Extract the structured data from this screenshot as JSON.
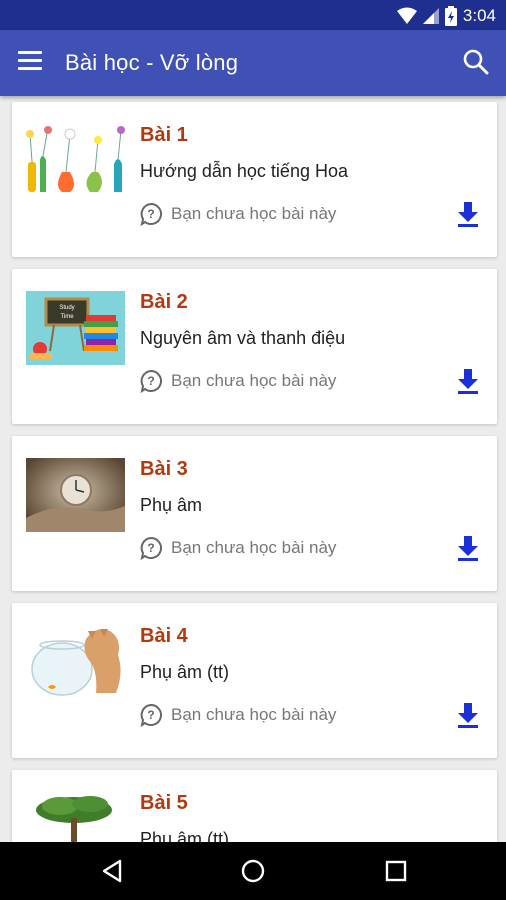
{
  "status_bar": {
    "time": "3:04",
    "icons": [
      "wifi-icon",
      "signal-icon",
      "battery-icon"
    ]
  },
  "app_bar": {
    "title": "Bài học - Vỡ lòng",
    "menu_icon": "hamburger-menu-icon",
    "search_icon": "search-icon",
    "color": "#3f51b5"
  },
  "lessons": [
    {
      "number": "Bài 1",
      "title": "Hướng dẫn học tiếng Hoa",
      "status": "Bạn chưa học bài này",
      "thumbnail": "flower-vases-image"
    },
    {
      "number": "Bài 2",
      "title": "Nguyên âm và thanh điệu",
      "status": "Bạn chưa học bài này",
      "thumbnail": "study-time-books-image"
    },
    {
      "number": "Bài 3",
      "title": "Phụ âm",
      "status": "Bạn chưa học bài này",
      "thumbnail": "clock-in-hand-image"
    },
    {
      "number": "Bài 4",
      "title": "Phụ âm (tt)",
      "status": "Bạn chưa học bài này",
      "thumbnail": "cat-fishbowl-image"
    },
    {
      "number": "Bài 5",
      "title": "Phụ âm (tt)",
      "status": "",
      "thumbnail": "tree-in-hand-image"
    }
  ],
  "colors": {
    "lesson_number": "#b23a10",
    "download": "#1a2fd6",
    "status_bar": "#1f2f8f"
  },
  "nav_bar": {
    "back_icon": "back-triangle-icon",
    "home_icon": "home-circle-icon",
    "recents_icon": "recents-square-icon"
  }
}
